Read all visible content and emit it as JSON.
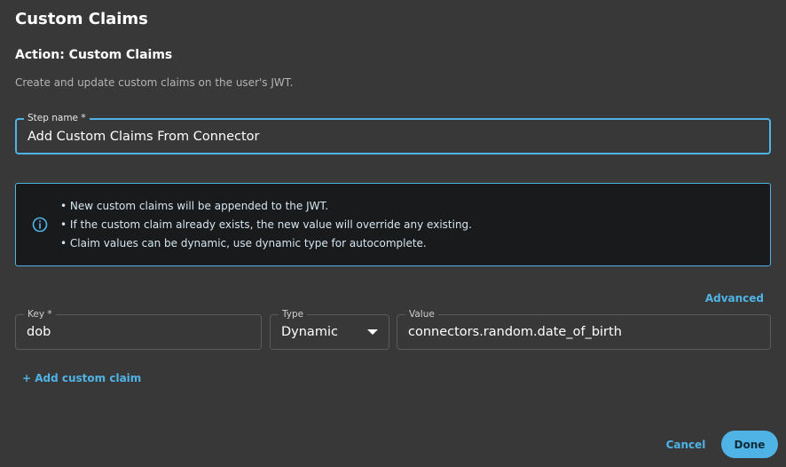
{
  "dialog": {
    "title": "Custom Claims",
    "action_title": "Action: Custom Claims",
    "description": "Create and update custom claims on the user's JWT."
  },
  "step_name": {
    "label": "Step name *",
    "value": "Add Custom Claims From Connector"
  },
  "info": {
    "icon": "info-icon",
    "items": [
      "New custom claims will be appended to the JWT.",
      "If the custom claim already exists, the new value will override any existing.",
      "Claim values can be dynamic, use dynamic type for autocomplete."
    ]
  },
  "advanced_label": "Advanced",
  "claim": {
    "key_label": "Key *",
    "key_value": "dob",
    "type_label": "Type",
    "type_value": "Dynamic",
    "value_label": "Value",
    "value_value": "connectors.random.date_of_birth"
  },
  "add_claim_label": "+ Add custom claim",
  "footer": {
    "cancel_label": "Cancel",
    "done_label": "Done"
  },
  "colors": {
    "background": "#383838",
    "accent": "#4fb3e6",
    "info_background": "#181a1c"
  }
}
